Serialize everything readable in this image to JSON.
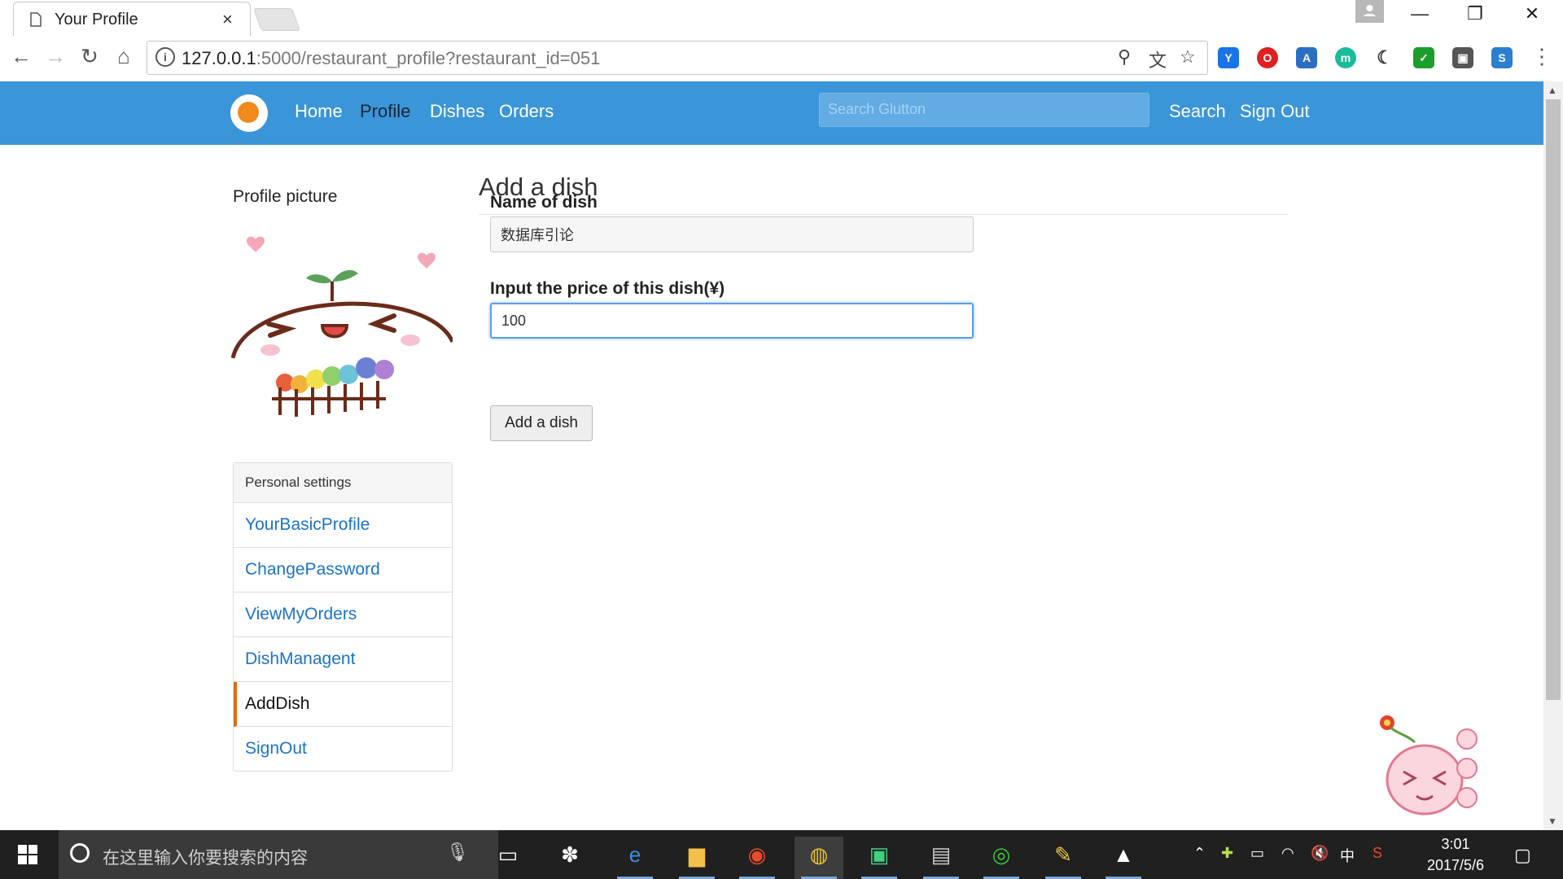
{
  "browser": {
    "tab_title": "Your Profile",
    "tab_close": "×",
    "url_host": "127.0.0.1",
    "url_rest": ":5000/restaurant_profile?restaurant_id=051",
    "info_glyph": "i",
    "window_controls": {
      "minimize": "—",
      "restore": "❐",
      "close": "✕"
    }
  },
  "navbar": {
    "links": [
      "Home",
      "Profile",
      "Dishes",
      "Orders"
    ],
    "active": "Profile",
    "search_placeholder": "Search Glutton",
    "search_label": "Search",
    "signout_label": "Sign Out"
  },
  "sidebar": {
    "title": "Profile picture",
    "heading": "Personal settings",
    "items": [
      {
        "label": "YourBasicProfile",
        "active": false
      },
      {
        "label": "ChangePassword",
        "active": false
      },
      {
        "label": "ViewMyOrders",
        "active": false
      },
      {
        "label": "DishManagent",
        "active": false
      },
      {
        "label": "AddDish",
        "active": true
      },
      {
        "label": "SignOut",
        "active": false
      }
    ]
  },
  "form": {
    "title": "Add a dish",
    "name_label": "Name of dish",
    "name_value": "数据库引论",
    "price_label": "Input the price of this dish(¥)",
    "price_value": "100",
    "submit_label": "Add a dish"
  },
  "taskbar": {
    "search_placeholder": "在这里输入你要搜索的内容",
    "ime": "中",
    "time": "3:01",
    "date": "2017/5/6"
  },
  "colors": {
    "navbar": "#3b95d9",
    "link": "#1a73c8",
    "active_marker": "#e06a1b"
  }
}
